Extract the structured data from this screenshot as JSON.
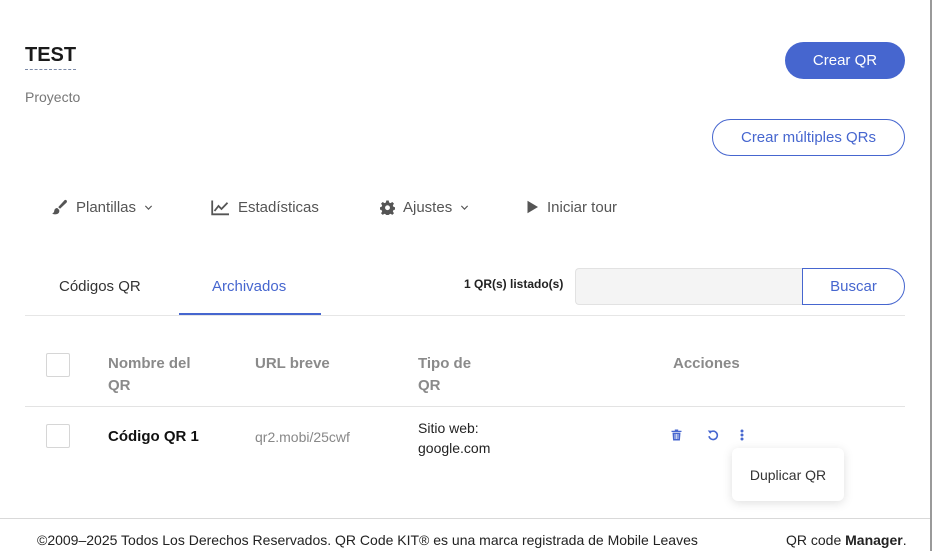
{
  "project": {
    "title": "TEST",
    "subtitle": "Proyecto"
  },
  "header": {
    "create_label": "Crear QR",
    "create_multi_label": "Crear múltiples QRs"
  },
  "nav": {
    "templates": {
      "label": "Plantillas",
      "icon": "brush-icon"
    },
    "stats": {
      "label": "Estadísticas",
      "icon": "line-chart-icon"
    },
    "settings": {
      "label": "Ajustes",
      "icon": "gear-icon"
    },
    "tour": {
      "label": "Iniciar tour",
      "icon": "play-icon"
    }
  },
  "tabs": {
    "codes": "Códigos QR",
    "archived": "Archivados",
    "active": "Archivados"
  },
  "search": {
    "count_label": "1 QR(s) listado(s)",
    "placeholder": "",
    "value": "",
    "button_label": "Buscar"
  },
  "table": {
    "headers": {
      "name": [
        "Nombre del",
        "QR"
      ],
      "url": "URL breve",
      "type": [
        "Tipo de",
        "QR"
      ],
      "actions": "Acciones"
    },
    "rows": [
      {
        "name": "Código QR 1",
        "url": "qr2.mobi/25cwf",
        "type": [
          "Sitio web:",
          "google.com"
        ]
      }
    ]
  },
  "actions_menu": {
    "item": "Duplicar QR"
  },
  "footer": {
    "copyright": "©2009–2025 Todos Los Derechos Reservados. QR Code KIT® es una marca registrada de Mobile Leaves",
    "brand_prefix": "QR code ",
    "brand_bold": "Manager",
    "brand_suffix": "."
  },
  "colors": {
    "accent": "#4666cf",
    "muted": "#8a8a8a"
  }
}
